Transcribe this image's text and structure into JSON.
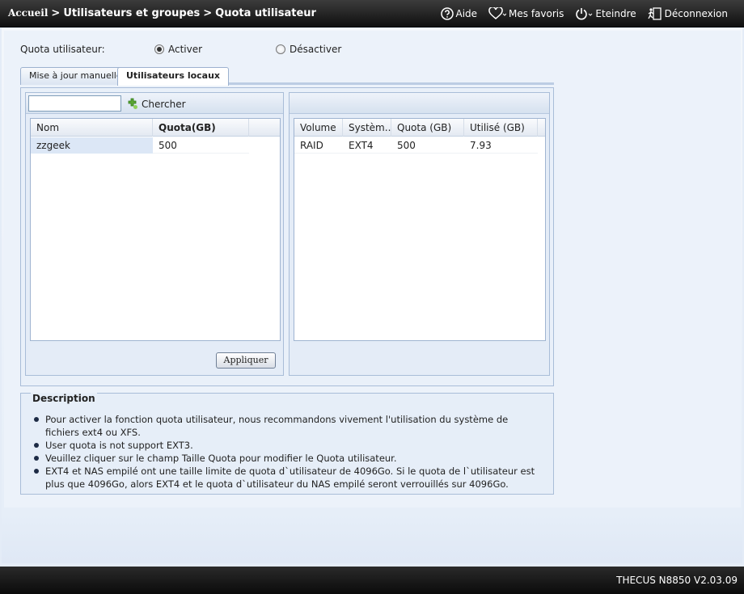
{
  "header": {
    "breadcrumb": [
      "Accueil",
      "Utilisateurs et groupes",
      "Quota utilisateur"
    ],
    "separator": ">",
    "nav": [
      "Aide",
      "Mes favoris",
      "Eteindre",
      "Déconnexion"
    ]
  },
  "quota": {
    "label": "Quota utilisateur:",
    "enable_label": "Activer",
    "disable_label": "Désactiver",
    "selected": "Activer"
  },
  "tabs": [
    "Mise à jour manuelle",
    "Utilisateurs locaux"
  ],
  "active_tab": "Utilisateurs locaux",
  "users": {
    "search_value": "",
    "search_label": "Chercher",
    "columns": [
      "Nom",
      "Quota(GB)"
    ],
    "rows": [
      {
        "name": "zzgeek",
        "quota": "500"
      }
    ]
  },
  "volumes": {
    "columns": [
      "Volume",
      "Systèm...",
      "Quota (GB)",
      "Utilisé (GB)"
    ],
    "rows": [
      {
        "volume": "RAID",
        "system": "EXT4",
        "quota": "500",
        "used": "7.93"
      }
    ]
  },
  "apply_label": "Appliquer",
  "description": {
    "title": "Description",
    "items": [
      "Pour activer la fonction quota utilisateur, nous recommandons vivement l'utilisation du système de fichiers ext4 ou XFS.",
      "User quota is not support EXT3.",
      "Veuillez cliquer sur le champ Taille Quota pour modifier le Quota utilisateur.",
      "EXT4 et NAS empilé ont une taille limite de quota d`utilisateur de 4096Go. Si le quota de l`utilisateur est plus que 4096Go, alors EXT4 et le quota d`utilisateur du NAS empilé seront verrouillés sur 4096Go."
    ]
  },
  "footer": {
    "version": "THECUS N8850 V2.03.09"
  },
  "colors": {
    "header": "#1e1e1e",
    "background": "#e4ecf7",
    "border": "#a9bdd8"
  },
  "icons": [
    "help-icon",
    "heart-icon",
    "power-icon",
    "logout-icon",
    "search-icon"
  ]
}
